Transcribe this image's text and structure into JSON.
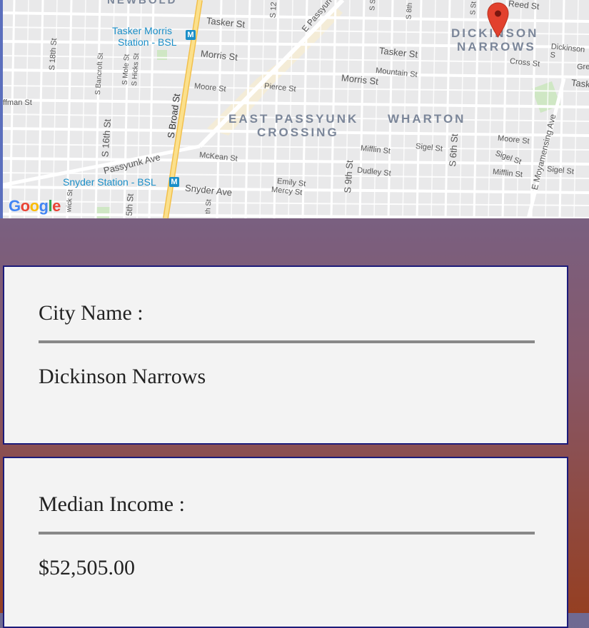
{
  "map": {
    "logo": "Google",
    "labels": {
      "newbold": "NEWBOLD",
      "tasker_morris_station": "Tasker Morris",
      "tasker_morris_station2": "Station - BSL",
      "snyder_station": "Snyder Station - BSL",
      "east_passyunk": "EAST PASSYUNK",
      "east_passyunk_crossing": "CROSSING",
      "wharton": "WHARTON",
      "dickinson": "DICKINSON",
      "narrows": "NARROWS",
      "tasker_st": "Tasker St",
      "tasker_st2": "Tasker St",
      "tasker_st3": "Tasker",
      "morris_st": "Morris St",
      "morris_st2": "Morris St",
      "moore_st": "Moore St",
      "moore_st2": "Moore St",
      "pierce_st": "Pierce St",
      "mckean_st": "McKean St",
      "mifflin_st": "Mifflin St",
      "mifflin_st2": "Mifflin St",
      "dudley_st": "Dudley St",
      "sigel_st": "Sigel St",
      "sigel_st2": "Sigel St",
      "sigel_st3": "Sigel St",
      "emily_st": "Emily St",
      "mercy_st": "Mercy St",
      "snyder_ave": "Snyder Ave",
      "passyunk_ave": "Passyunk Ave",
      "e_passyunk": "E Passyun",
      "s_broad_st": "S Broad St",
      "s_16th_st": "S 16th St",
      "s_18th_st": "S 18th St",
      "s_bancroft_st": "S Bancroft St",
      "s_mole_st": "S Mole St",
      "s_hicks_st": "S Hicks St",
      "s_9th_st": "S 9th St",
      "s_6th_st": "S 6th St",
      "e_moyamensing": "E Moyamensing Ave",
      "cross_st": "Cross St",
      "dickinson_st": "Dickinson S",
      "mountain_st": "Mountain St",
      "reed_st": "Reed St",
      "fman_st": "ffman St",
      "fifth_st": "5th St",
      "s_12": "S 12",
      "s_8th": "S 8th",
      "gre": "Gre",
      "wick_st": "wick St",
      "s_st": "S St",
      "th_st": "th St",
      "s_st2": "S St"
    }
  },
  "cards": [
    {
      "label": "City Name :",
      "value": "Dickinson Narrows"
    },
    {
      "label": "Median Income :",
      "value": "$52,505.00"
    }
  ],
  "colors": {
    "card_border": "#1c1b7a",
    "card_bg": "#f3f3f3",
    "rule": "#888888",
    "marker": "#e2412e",
    "broad_st": "#f7d36b"
  }
}
